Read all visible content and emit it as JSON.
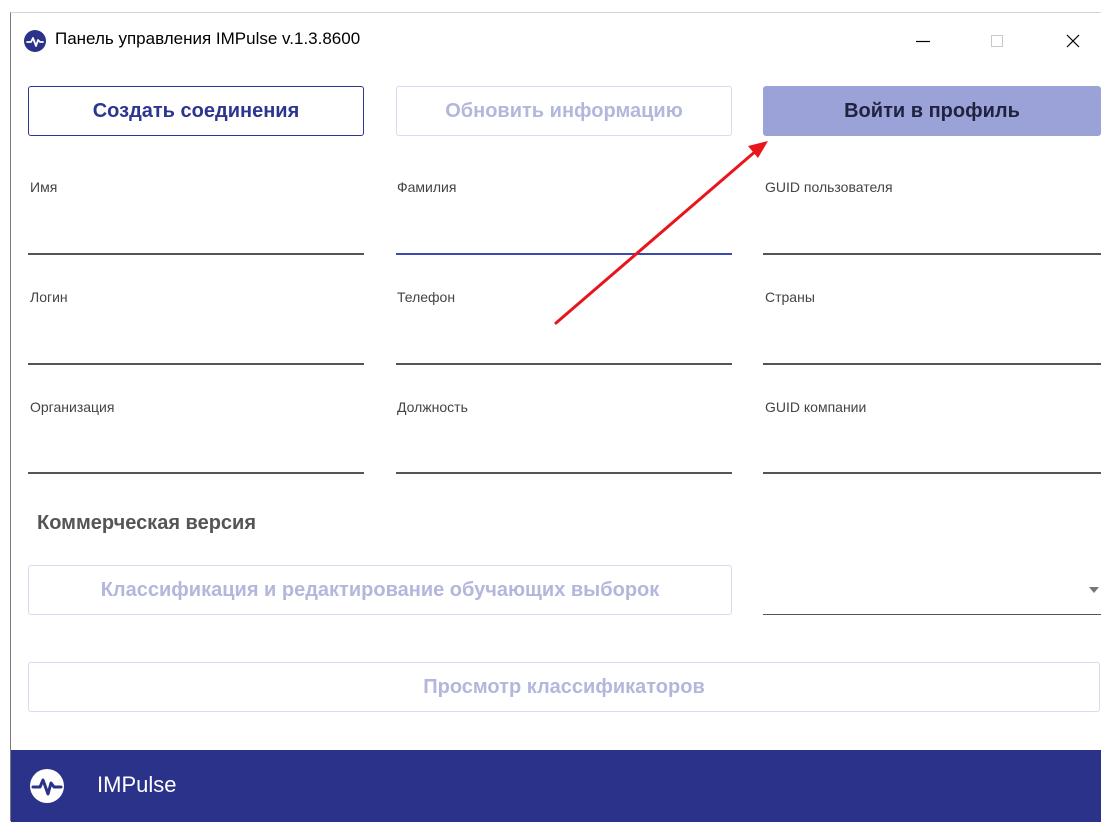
{
  "window": {
    "title": "Панель управления IMPulse v.1.3.8600"
  },
  "buttons": {
    "create_label": "Создать соединения",
    "refresh_label": "Обновить информацию",
    "login_label": "Войти в профиль",
    "classify_label": "Классификация и редактирование обучающих выборок",
    "view_label": "Просмотр классификаторов"
  },
  "fields": {
    "name": {
      "label": "Имя",
      "value": ""
    },
    "surname": {
      "label": "Фамилия",
      "value": ""
    },
    "user_guid": {
      "label": "GUID пользователя",
      "value": ""
    },
    "login": {
      "label": "Логин",
      "value": ""
    },
    "phone": {
      "label": "Телефон",
      "value": ""
    },
    "countries": {
      "label": "Страны",
      "value": ""
    },
    "organization": {
      "label": "Организация",
      "value": ""
    },
    "position": {
      "label": "Должность",
      "value": ""
    },
    "company_guid": {
      "label": "GUID компании",
      "value": ""
    }
  },
  "commercial": {
    "title": "Коммерческая версия",
    "dropdown_value": ""
  },
  "footer": {
    "brand": "IMPulse"
  },
  "icons": {
    "app": "impulse-logo-icon",
    "minimize": "minimize-icon",
    "maximize": "maximize-icon",
    "close": "close-icon",
    "dropdown": "chevron-down-icon"
  },
  "colors": {
    "accent": "#2c3590",
    "footer_bg": "#2a3289",
    "login_button_bg": "#9aa2d8",
    "disabled_text": "#b3b7dc",
    "annotation_arrow": "#e8161b"
  }
}
